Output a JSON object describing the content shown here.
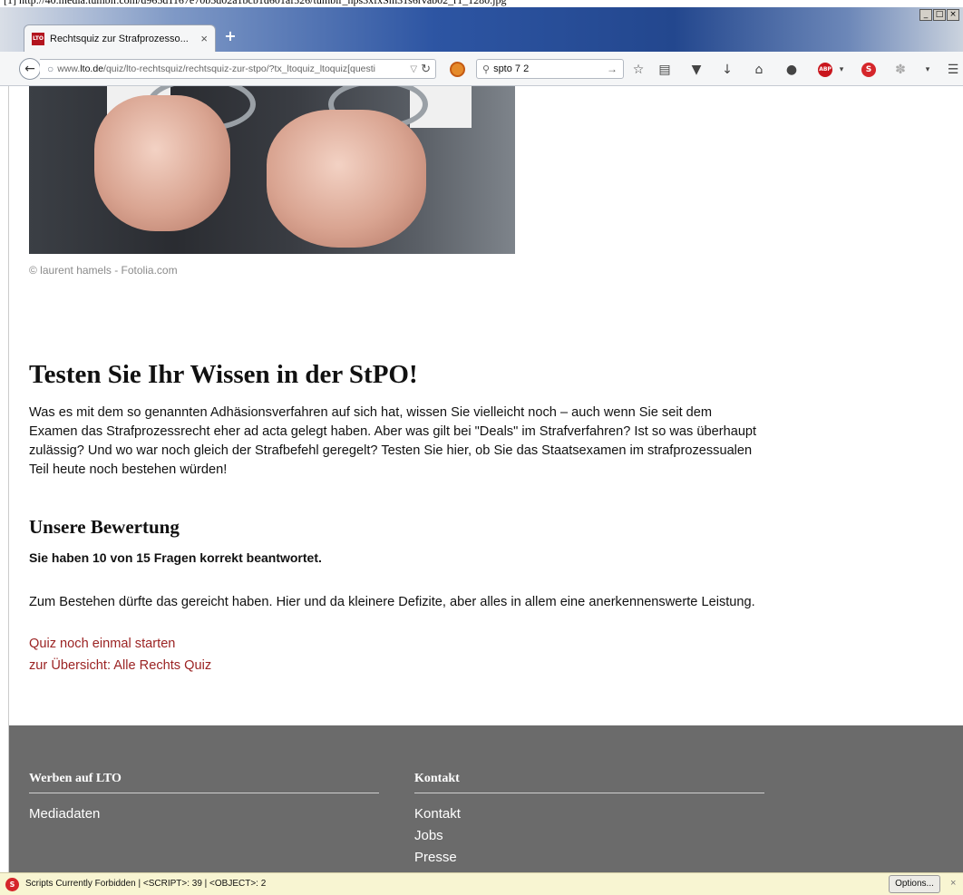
{
  "url_strip": "[1] http://40.media.tumblr.com/d965d1167e70b5d02a1bcb1d601af526/tumblr_nps3xfxSm31s6rvab02_r1_1280.jpg",
  "browser": {
    "tab": {
      "favicon_text": "LTO",
      "title": "Rechtsquiz zur Strafprozesso...",
      "close": "×"
    },
    "new_tab": "+",
    "window_controls": [
      "_",
      "□",
      "×"
    ],
    "url": {
      "prefix": "www.",
      "domain": "lto.de",
      "path": "/quiz/lto-rechtsquiz/rechtsquiz-zur-stpo/?tx_ltoquiz_ltoquiz[questi"
    },
    "search": {
      "value": "spto 7 2"
    },
    "toolbar_icons": [
      "star-icon",
      "reading-list-icon",
      "pocket-icon",
      "download-icon",
      "home-icon",
      "chat-icon",
      "adblock-icon",
      "noscript-icon",
      "extension-icon",
      "menu-icon"
    ],
    "abp_label": "ABP"
  },
  "page": {
    "photo_credit": "© laurent hamels - Fotolia.com",
    "heading": "Testen Sie Ihr Wissen in der StPO!",
    "intro": "Was es mit dem so genannten Adhäsionsverfahren auf sich hat, wissen Sie vielleicht noch – auch wenn Sie seit dem Examen das Strafprozessrecht eher ad acta gelegt haben. Aber was gilt bei \"Deals\" im Strafverfahren? Ist so was überhaupt zulässig? Und wo war noch gleich der Strafbefehl geregelt? Testen Sie hier, ob Sie das Staatsexamen im strafprozessualen Teil heute noch bestehen würden!",
    "rating_heading": "Unsere Bewertung",
    "score": "Sie haben 10 von 15 Fragen korrekt beantwortet.",
    "verdict": "Zum Bestehen dürfte das gereicht haben. Hier und da kleinere Defizite, aber alles in allem eine anerkennenswerte Leistung.",
    "restart_link": "Quiz noch einmal starten",
    "overview_link": "zur Übersicht: Alle Rechts Quiz"
  },
  "footer": {
    "col1": {
      "heading": "Werben auf LTO",
      "links": [
        "Mediadaten"
      ]
    },
    "col2": {
      "heading": "Kontakt",
      "links": [
        "Kontakt",
        "Jobs",
        "Presse"
      ]
    }
  },
  "statusbar": {
    "text": "Scripts Currently Forbidden | <SCRIPT>: 39 | <OBJECT>: 2",
    "options": "Options...",
    "close": "×"
  }
}
